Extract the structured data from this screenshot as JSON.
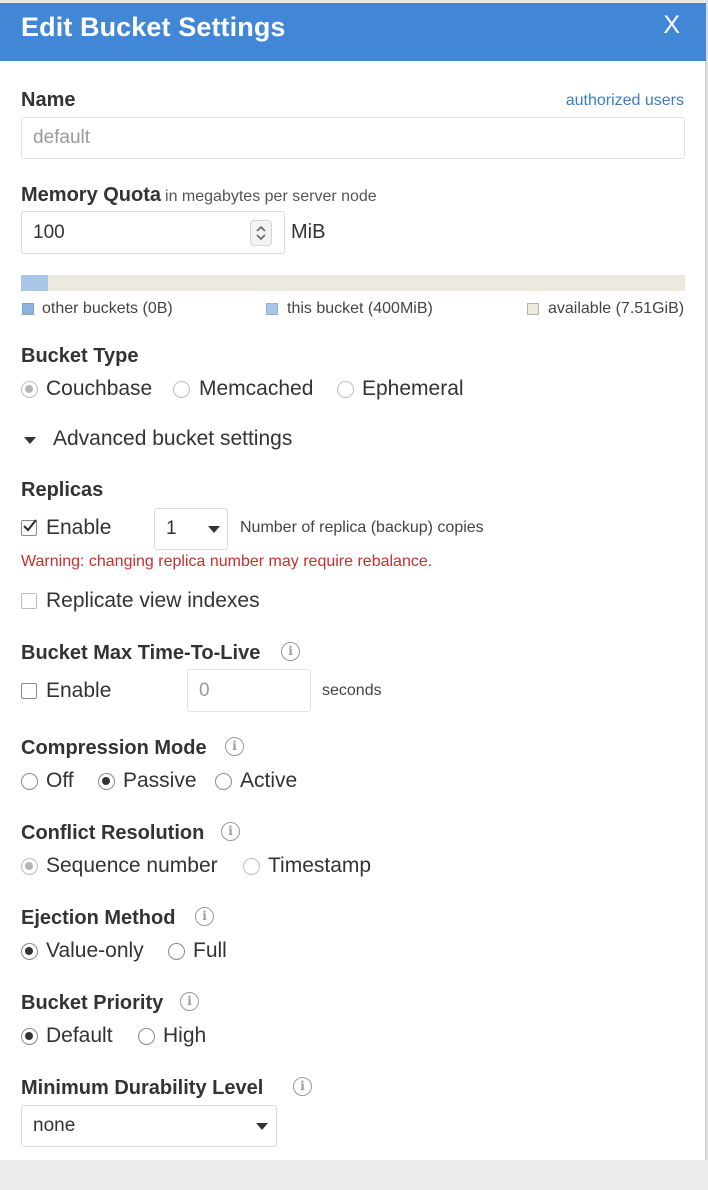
{
  "dialog": {
    "title": "Edit Bucket Settings",
    "close": "X"
  },
  "name": {
    "label": "Name",
    "link": "authorized users",
    "value": "default"
  },
  "memory": {
    "label": "Memory Quota",
    "sublabel": "in megabytes per server node",
    "value": "100",
    "unit": "MiB",
    "usage_fraction": 0.04,
    "legend": {
      "other": "other buckets (0B)",
      "this": "this bucket (400MiB)",
      "available": "available (7.51GiB)"
    }
  },
  "bucket_type": {
    "label": "Bucket Type",
    "options": [
      "Couchbase",
      "Memcached",
      "Ephemeral"
    ],
    "selected": "Couchbase"
  },
  "advanced": {
    "label": "Advanced bucket settings"
  },
  "replicas": {
    "label": "Replicas",
    "enable_label": "Enable",
    "enabled": true,
    "count": "1",
    "count_desc": "Number of replica (backup) copies",
    "warning": "Warning: changing replica number may require rebalance.",
    "view_index_label": "Replicate view indexes",
    "view_index_checked": false
  },
  "ttl": {
    "label": "Bucket Max Time-To-Live",
    "enable_label": "Enable",
    "enabled": false,
    "value_placeholder": "0",
    "unit": "seconds"
  },
  "compression": {
    "label": "Compression Mode",
    "options": [
      "Off",
      "Passive",
      "Active"
    ],
    "selected": "Passive"
  },
  "conflict": {
    "label": "Conflict Resolution",
    "options": [
      "Sequence number",
      "Timestamp"
    ],
    "selected": "Sequence number"
  },
  "ejection": {
    "label": "Ejection Method",
    "options": [
      "Value-only",
      "Full"
    ],
    "selected": "Value-only"
  },
  "priority": {
    "label": "Bucket Priority",
    "options": [
      "Default",
      "High"
    ],
    "selected": "Default"
  },
  "durability": {
    "label": "Minimum Durability Level",
    "value": "none"
  },
  "icons": {
    "info": "i"
  },
  "colors": {
    "header": "#4287d6",
    "link": "#3a7cc6",
    "warning": "#c9302c",
    "this_bucket": "#a9c6e8",
    "other_bucket": "#8fb2dc",
    "available": "#eee9df"
  }
}
